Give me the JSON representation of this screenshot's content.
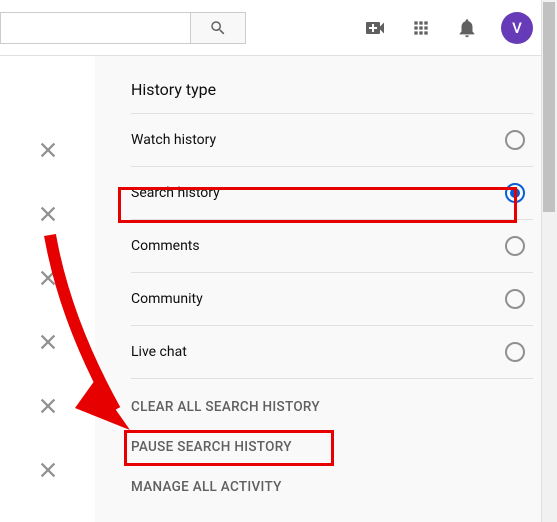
{
  "header": {
    "search_placeholder": "",
    "avatar_letter": "V"
  },
  "panel": {
    "title": "History type",
    "options": [
      {
        "label": "Watch history",
        "selected": false
      },
      {
        "label": "Search history",
        "selected": true
      },
      {
        "label": "Comments",
        "selected": false
      },
      {
        "label": "Community",
        "selected": false
      },
      {
        "label": "Live chat",
        "selected": false
      }
    ],
    "actions": {
      "clear": "CLEAR ALL SEARCH HISTORY",
      "pause": "PAUSE SEARCH HISTORY",
      "manage": "MANAGE ALL ACTIVITY"
    }
  }
}
